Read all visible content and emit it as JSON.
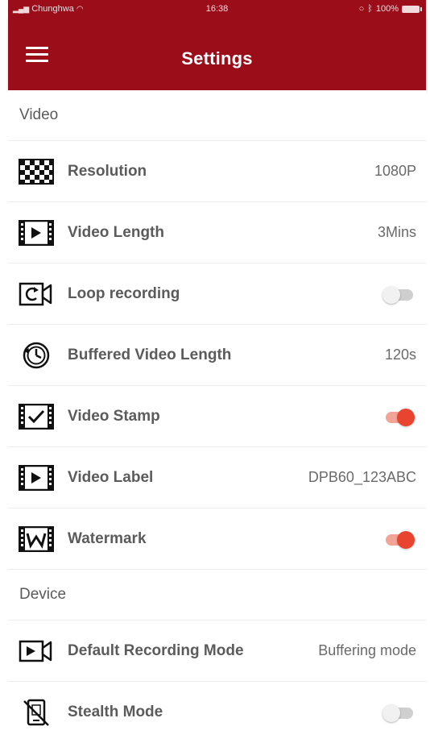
{
  "status_bar": {
    "carrier": "Chunghwa",
    "time": "16:38",
    "battery": "100%"
  },
  "app_bar": {
    "title": "Settings"
  },
  "sections": {
    "video": {
      "header": "Video",
      "resolution": {
        "label": "Resolution",
        "value": "1080P",
        "icon": "checkerboard-icon"
      },
      "video_length": {
        "label": "Video Length",
        "value": "3Mins",
        "icon": "film-play-icon"
      },
      "loop_recording": {
        "label": "Loop recording",
        "toggle": false,
        "icon": "loop-camera-icon"
      },
      "buffered_video_length": {
        "label": "Buffered Video Length",
        "value": "120s",
        "icon": "clock-back-icon"
      },
      "video_stamp": {
        "label": "Video Stamp",
        "toggle": true,
        "icon": "film-check-icon"
      },
      "video_label": {
        "label": "Video Label",
        "value": "DPB60_123ABC",
        "icon": "film-play-icon"
      },
      "watermark": {
        "label": "Watermark",
        "toggle": true,
        "icon": "film-w-icon"
      }
    },
    "device": {
      "header": "Device",
      "default_recording_mode": {
        "label": "Default Recording Mode",
        "value": "Buffering mode",
        "icon": "video-camera-icon"
      },
      "stealth_mode": {
        "label": "Stealth Mode",
        "toggle": false,
        "icon": "no-phone-icon"
      }
    }
  },
  "colors": {
    "app_bar": "#9c0d1a",
    "toggle_on": "#e8442f",
    "toggle_on_track": "#f2a597",
    "toggle_off_track": "#cfcfcf"
  }
}
